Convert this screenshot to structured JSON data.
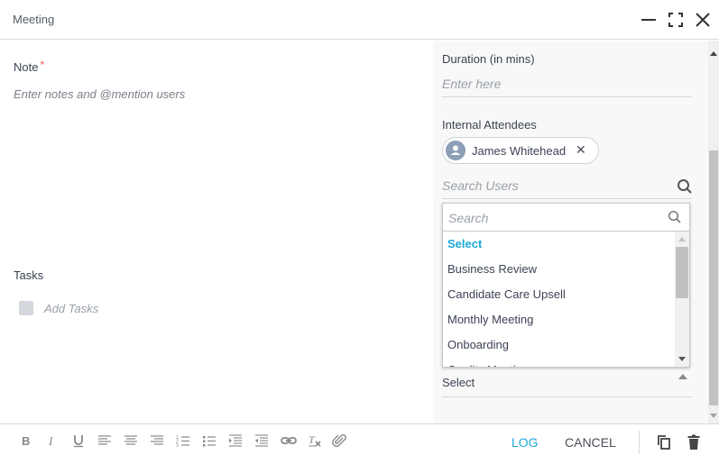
{
  "window": {
    "title": "Meeting",
    "controls": [
      "minimize-icon",
      "maximize-icon",
      "close-icon"
    ]
  },
  "note": {
    "label": "Note",
    "required_marker": "*",
    "placeholder": "Enter notes and @mention users"
  },
  "tasks": {
    "label": "Tasks",
    "placeholder": "Add Tasks"
  },
  "duration": {
    "label": "Duration (in mins)",
    "placeholder": "Enter here"
  },
  "attendees": {
    "label": "Internal Attendees",
    "chips": [
      {
        "name": "James Whitehead",
        "remove_glyph": "✕"
      }
    ],
    "search_placeholder": "Search Users"
  },
  "dropdown": {
    "search_placeholder": "Search",
    "options": [
      {
        "label": "Select",
        "selected": true
      },
      {
        "label": "Business Review",
        "selected": false
      },
      {
        "label": "Candidate Care Upsell",
        "selected": false
      },
      {
        "label": "Monthly Meeting",
        "selected": false
      },
      {
        "label": "Onboarding",
        "selected": false
      },
      {
        "label": "Quality Meeting",
        "selected": false
      }
    ]
  },
  "select_field": {
    "value": "Select"
  },
  "toolbar": {
    "icons": [
      "bold-icon",
      "italic-icon",
      "underline-icon",
      "align-left-icon",
      "align-center-icon",
      "align-right-icon",
      "ordered-list-icon",
      "unordered-list-icon",
      "indent-icon",
      "outdent-icon",
      "link-icon",
      "clear-format-icon",
      "attachment-icon"
    ]
  },
  "footer": {
    "log_label": "LOG",
    "cancel_label": "CANCEL"
  },
  "colors": {
    "accent": "#1ba9d8",
    "required": "#e8594f",
    "text": "#3b4252",
    "placeholder": "#9aa0a8"
  }
}
